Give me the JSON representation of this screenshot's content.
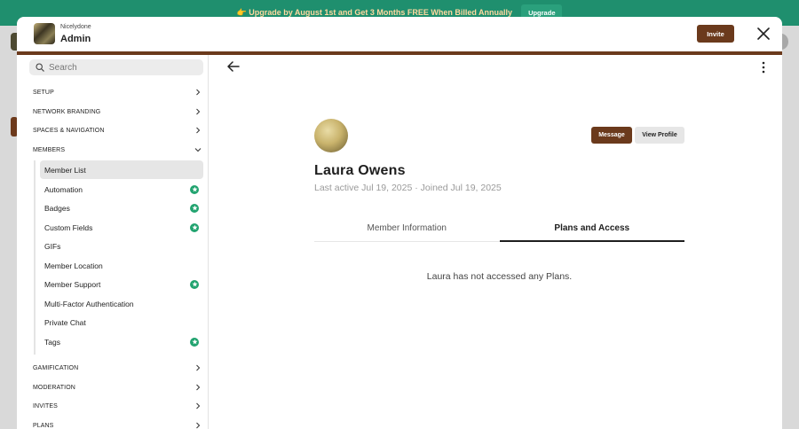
{
  "banner": {
    "text": "👉 Upgrade by August 1st and Get 3 Months FREE When Billed Annually",
    "button": "Upgrade"
  },
  "header": {
    "org_name": "Nicelydone",
    "role": "Admin",
    "invite_label": "Invite"
  },
  "nav": {
    "search_placeholder": "Search",
    "sections_top": [
      "SETUP",
      "NETWORK BRANDING",
      "SPACES & NAVIGATION",
      "MEMBERS"
    ],
    "members_items": [
      {
        "label": "Member List",
        "badge": false,
        "active": true
      },
      {
        "label": "Automation",
        "badge": true
      },
      {
        "label": "Badges",
        "badge": true
      },
      {
        "label": "Custom Fields",
        "badge": true
      },
      {
        "label": "GIFs",
        "badge": false
      },
      {
        "label": "Member Location",
        "badge": false
      },
      {
        "label": "Member Support",
        "badge": true
      },
      {
        "label": "Multi-Factor Authentication",
        "badge": false
      },
      {
        "label": "Private Chat",
        "badge": false
      },
      {
        "label": "Tags",
        "badge": true
      }
    ],
    "sections_bottom": [
      "GAMIFICATION",
      "MODERATION",
      "INVITES",
      "PLANS"
    ]
  },
  "profile": {
    "name": "Laura Owens",
    "meta": "Last active Jul 19, 2025 · Joined Jul 19, 2025",
    "message_label": "Message",
    "view_profile_label": "View Profile",
    "tabs": [
      "Member Information",
      "Plans and Access"
    ],
    "active_tab": 1,
    "empty_message": "Laura has not accessed any Plans."
  },
  "colors": {
    "brand": "#6b3a1c",
    "banner": "#1f8f6e",
    "badge": "#21a36f"
  },
  "icons": {
    "search": "search-icon",
    "close": "close-icon",
    "back": "arrow-left-icon",
    "more": "more-vertical-icon",
    "chevron_right": "chevron-right-icon",
    "chevron_down": "chevron-down-icon",
    "star": "star-icon"
  }
}
